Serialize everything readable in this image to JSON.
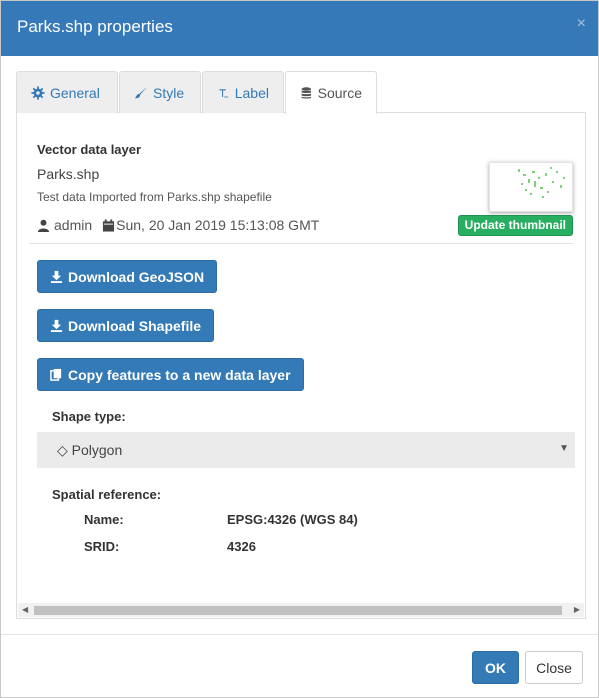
{
  "dialog": {
    "title": "Parks.shp properties",
    "close_symbol": "×"
  },
  "tabs": [
    {
      "label": "General",
      "icon": "gear-icon"
    },
    {
      "label": "Style",
      "icon": "brush-icon"
    },
    {
      "label": "Label",
      "icon": "text-icon"
    },
    {
      "label": "Source",
      "icon": "database-icon",
      "active": true
    }
  ],
  "source": {
    "section_title": "Vector data layer",
    "layer_name": "Parks.shp",
    "description": "Test data Imported from Parks.shp shapefile",
    "owner": "admin",
    "date": "Sun, 20 Jan 2019 15:13:08 GMT",
    "update_thumbnail_label": "Update thumbnail",
    "download_geojson_label": "Download GeoJSON",
    "download_shapefile_label": "Download Shapefile",
    "copy_features_label": "Copy features to a new data layer",
    "shape_type_label": "Shape type:",
    "shape_type_value": "◇ Polygon",
    "spatial_reference_label": "Spatial reference:",
    "name_key": "Name:",
    "name_value": "EPSG:4326 (WGS 84)",
    "srid_key": "SRID:",
    "srid_value": "4326"
  },
  "footer": {
    "ok_label": "OK",
    "close_label": "Close"
  },
  "colors": {
    "header": "#3579b8",
    "primary": "#337ab7",
    "success": "#27ae60"
  }
}
